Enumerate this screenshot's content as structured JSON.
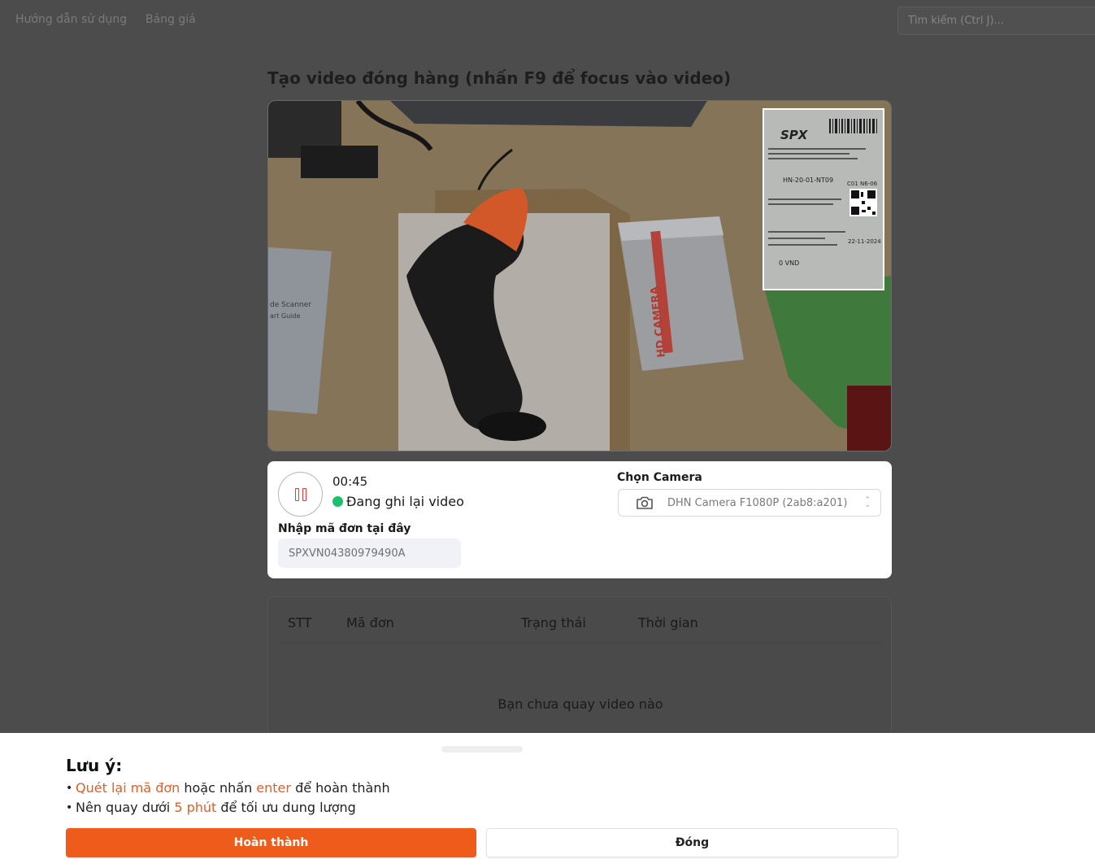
{
  "nav": {
    "guide": "Hướng dẫn sử dụng",
    "pricing": "Bảng giá",
    "search_placeholder": "Tìm kiếm (Ctrl J)..."
  },
  "page": {
    "title": "Tạo video đóng hàng (nhấn F9 để focus vào video)"
  },
  "recorder": {
    "timer": "00:45",
    "status": "Đang ghi lại video",
    "status_color": "#1cc26b",
    "order_label": "Nhập mã đơn tại đây",
    "order_value": "SPXVN04380979490A",
    "camera_label": "Chọn Camera",
    "camera_value": "DHN Camera F1080P (2ab8:a201)"
  },
  "table": {
    "columns": [
      "STT",
      "Mã đơn",
      "Trạng thái",
      "Thời gian"
    ],
    "empty_text": "Bạn chưa quay video nào"
  },
  "sheet": {
    "title": "Lưu ý:",
    "note1": {
      "hl1": "Quét lại mã đơn",
      "t1": " hoặc nhấn ",
      "hl2": "enter",
      "t2": " để hoàn thành"
    },
    "note2": {
      "t1": "Nên quay dưới ",
      "hl1": "5 phút",
      "t2": " để tối ưu dung lượng"
    },
    "done_label": "Hoàn thành",
    "close_label": "Đóng",
    "accent_color": "#ee5b1a"
  },
  "video": {
    "label_brand": "SPX",
    "label_route": "HN-20-01-NT09",
    "label_code": "C01 N6-06",
    "label_date": "22-11-2024",
    "label_price": "0 VND",
    "scanner_text_1": "de Scanner",
    "scanner_text_2": "art Guide",
    "box_text": "HD CAMERA"
  }
}
